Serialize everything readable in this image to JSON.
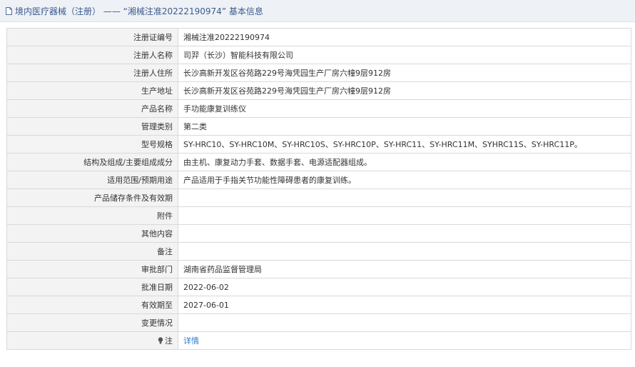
{
  "header": {
    "title": "境内医疗器械（注册） —— “湘械注准20222190974” 基本信息"
  },
  "rows": [
    {
      "label": "注册证编号",
      "value": "湘械注准20222190974"
    },
    {
      "label": "注册人名称",
      "value": "司羿（长沙）智能科技有限公司"
    },
    {
      "label": "注册人住所",
      "value": "长沙高新开发区谷苑路229号海凭园生产厂房六幢9层912房"
    },
    {
      "label": "生产地址",
      "value": "长沙高新开发区谷苑路229号海凭园生产厂房六幢9层912房"
    },
    {
      "label": "产品名称",
      "value": "手功能康复训练仪"
    },
    {
      "label": "管理类别",
      "value": "第二类"
    },
    {
      "label": "型号规格",
      "value": "SY-HRC10、SY-HRC10M、SY-HRC10S、SY-HRC10P、SY-HRC11、SY-HRC11M、SYHRC11S、SY-HRC11P。"
    },
    {
      "label": "结构及组成/主要组成成分",
      "value": "由主机、康复动力手套、数据手套、电源适配器组成。"
    },
    {
      "label": "适用范围/预期用途",
      "value": "产品适用于手指关节功能性障碍患者的康复训练。"
    },
    {
      "label": "产品储存条件及有效期",
      "value": ""
    },
    {
      "label": "附件",
      "value": ""
    },
    {
      "label": "其他内容",
      "value": ""
    },
    {
      "label": "备注",
      "value": ""
    },
    {
      "label": "审批部门",
      "value": "湖南省药品监督管理局"
    },
    {
      "label": "批准日期",
      "value": "2022-06-02"
    },
    {
      "label": "有效期至",
      "value": "2027-06-01"
    },
    {
      "label": "变更情况",
      "value": ""
    }
  ],
  "note": {
    "label": "注",
    "link_text": "详情",
    "icon": "lightbulb-icon"
  },
  "colors": {
    "title_text": "#3b5b8f",
    "title_bg": "#eef1f5",
    "label_bg": "#f3f3f3",
    "border": "#d9d9d9",
    "link": "#2f79c8"
  }
}
